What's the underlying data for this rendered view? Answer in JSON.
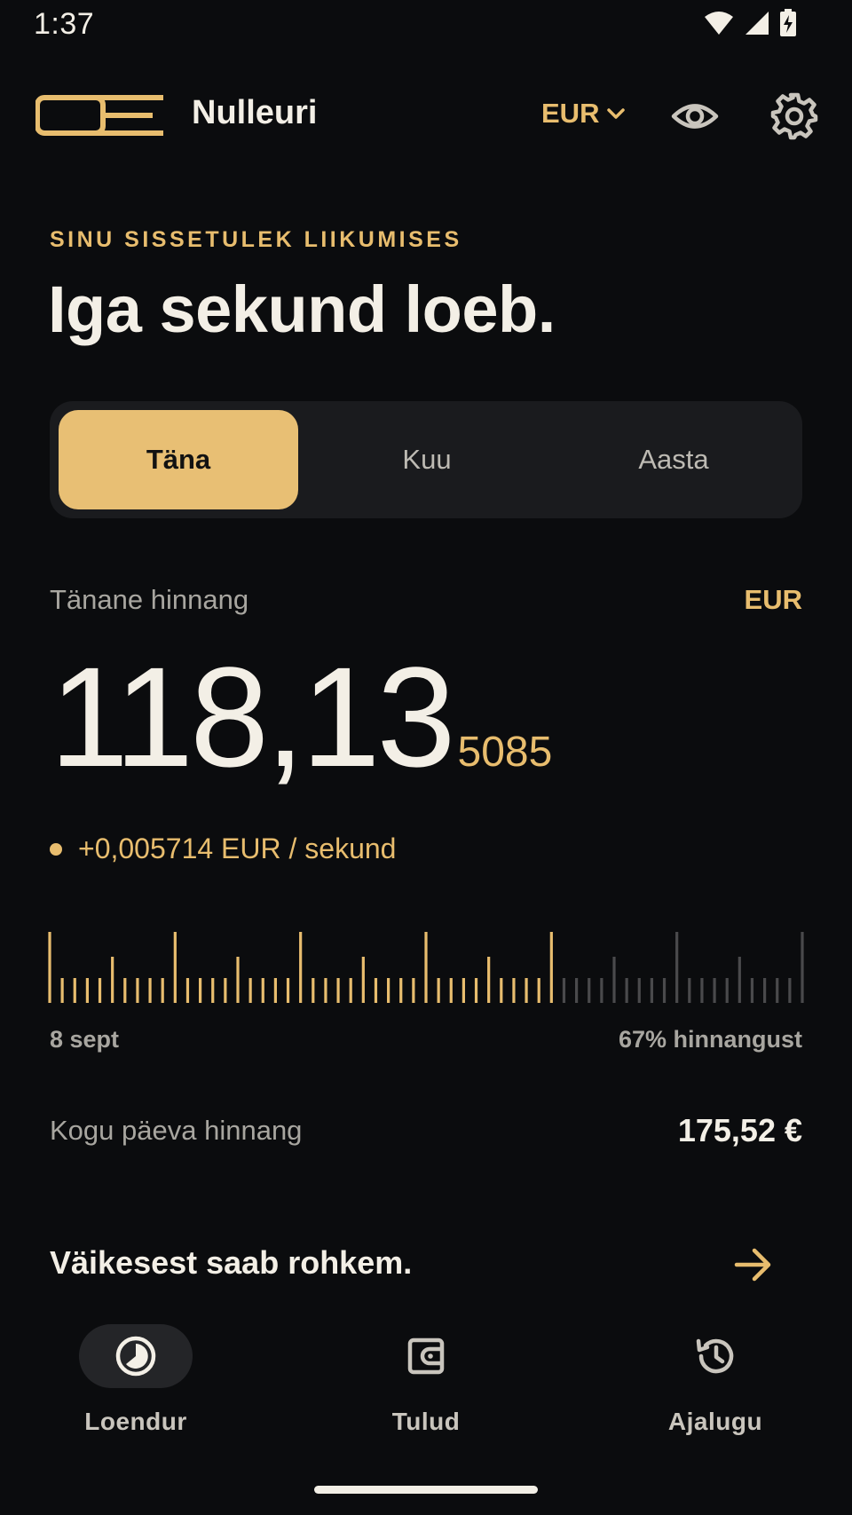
{
  "status_bar": {
    "time": "1:37",
    "icons": [
      "wifi-icon",
      "signal-icon",
      "battery-charging-icon"
    ]
  },
  "header": {
    "app_name": "Nulleuri",
    "currency_selector": "EUR",
    "icons": [
      "logo-icon",
      "chevron-down-icon",
      "eye-icon",
      "gear-icon"
    ]
  },
  "hero": {
    "eyebrow": "SINU SISSETULEK LIIKUMISES",
    "headline": "Iga sekund loeb."
  },
  "segments": {
    "items": [
      {
        "label": "Täna",
        "selected": true
      },
      {
        "label": "Kuu",
        "selected": false
      },
      {
        "label": "Aasta",
        "selected": false
      }
    ]
  },
  "estimate": {
    "label": "Tänane hinnang",
    "currency": "EUR",
    "amount_main": "118,13",
    "amount_fraction": "5085",
    "rate": "+0,005714 EUR / sekund"
  },
  "progress": {
    "start_label": "8 sept",
    "percent_label": "67% hinnangust",
    "fraction": 0.67
  },
  "total": {
    "label": "Kogu päeva hinnang",
    "value": "175,52 €"
  },
  "promo": {
    "title": "Väikesest saab rohkem."
  },
  "bottom_nav": {
    "items": [
      {
        "label": "Loendur",
        "icon": "timer-icon",
        "active": true
      },
      {
        "label": "Tulud",
        "icon": "wallet-icon",
        "active": false
      },
      {
        "label": "Ajalugu",
        "icon": "history-icon",
        "active": false
      }
    ]
  },
  "colors": {
    "background": "#0b0c0e",
    "accent": "#e8bd6e",
    "text": "#f3efe6",
    "muted": "#a8a6a0",
    "inactive_tick": "#4a4a4c"
  }
}
